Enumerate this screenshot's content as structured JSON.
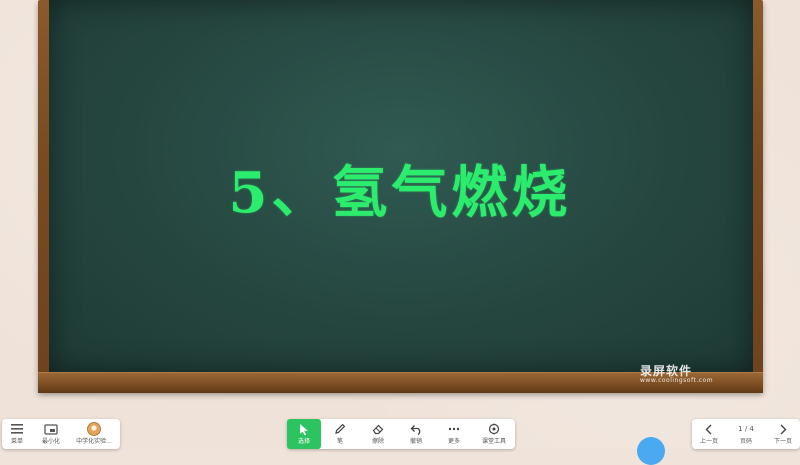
{
  "board": {
    "title": "5、氢气燃烧"
  },
  "watermark": {
    "text": "录屏软件",
    "url": "www.coolingsoft.com"
  },
  "toolbar_left": {
    "menu_label": "菜单",
    "minimize_label": "最小化",
    "app_label": "中学化实验..."
  },
  "toolbar_center": {
    "select_label": "选择",
    "pen_label": "笔",
    "eraser_label": "擦除",
    "undo_label": "撤销",
    "more_label": "更多",
    "lesson_label": "课堂工具"
  },
  "toolbar_right": {
    "prev_label": "上一页",
    "page_counter": "1 / 4",
    "pages_label": "页码",
    "next_label": "下一页"
  },
  "colors": {
    "board": "#25463f",
    "title_text": "#2cec6d",
    "active_tool": "#2bc460",
    "wall": "#efe2d8",
    "frame": "#7a4b22"
  }
}
